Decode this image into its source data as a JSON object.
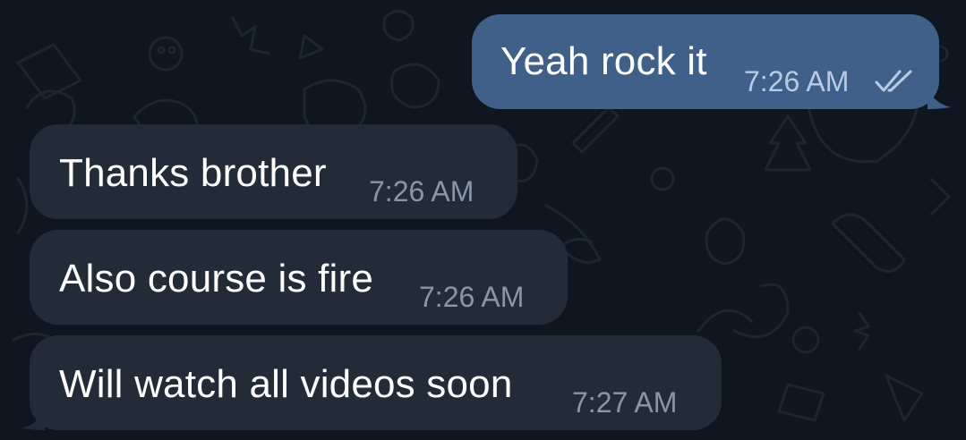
{
  "chat": {
    "messages": [
      {
        "direction": "outgoing",
        "text": "Yeah rock it",
        "time": "7:26 AM",
        "status": "read"
      },
      {
        "direction": "incoming",
        "text": "Thanks brother",
        "time": "7:26 AM"
      },
      {
        "direction": "incoming",
        "text": "Also course is fire",
        "time": "7:26 AM"
      },
      {
        "direction": "incoming",
        "text": "Will watch all videos soon",
        "time": "7:27 AM"
      }
    ],
    "status_icon": "double-check-icon"
  },
  "colors": {
    "background": "#0f1620",
    "incoming_bubble": "#212c38",
    "outgoing_bubble": "#3f6189",
    "text": "#ffffff",
    "time_incoming": "#8a96a3",
    "time_outgoing": "#b7cbe2"
  }
}
